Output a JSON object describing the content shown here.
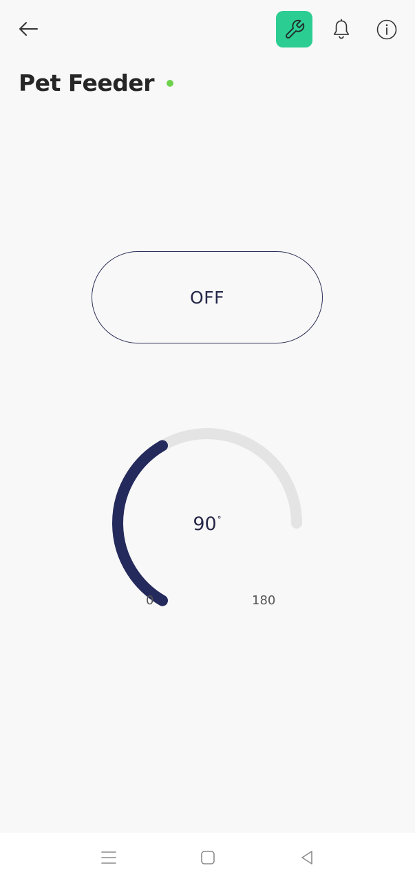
{
  "header": {
    "back_icon": "arrow-left-icon",
    "settings_icon": "wrench-icon",
    "notifications_icon": "bell-icon",
    "info_icon": "info-icon",
    "accent_color": "#2ccd92"
  },
  "device": {
    "name": "Pet Feeder",
    "online": true,
    "status_color": "#6fd24e"
  },
  "switch": {
    "label": "OFF",
    "state": "off"
  },
  "gauge": {
    "value": "90",
    "unit": "°",
    "min_label": "0",
    "max_label": "180",
    "min": 0,
    "max": 180,
    "current": 90,
    "fill_color": "#252a5c",
    "track_color": "#e4e4e4"
  },
  "navbar": {
    "menu_icon": "menu-icon",
    "home_icon": "square-home-icon",
    "back_icon": "triangle-back-icon"
  }
}
